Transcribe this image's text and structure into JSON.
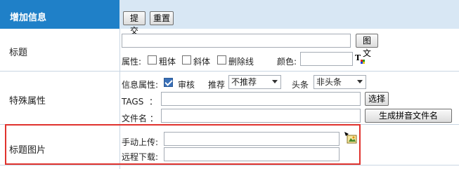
{
  "header": {
    "title": "增加信息",
    "submit_label": "提交",
    "reset_label": "重置"
  },
  "title_row": {
    "label": "标题",
    "title_value": "",
    "tuwen_button": "图文",
    "attr_label": "属性:",
    "bold_label": "粗体",
    "italic_label": "斜体",
    "strike_label": "删除线",
    "color_label": "颜色:",
    "color_value": ""
  },
  "special_row": {
    "label": "特殊属性",
    "info_attr_label": "信息属性:",
    "review_label": "审核",
    "review_checked": true,
    "recommend_label": "推荐",
    "recommend_value": "不推荐",
    "headline_label": "头条",
    "headline_value": "非头条",
    "tags_label": "TAGS  ：",
    "tags_value": "",
    "select_button": "选择",
    "filename_label": "文件名 ：",
    "filename_value": "",
    "pinyin_button": "生成拼音文件名"
  },
  "image_row": {
    "label": "标题图片",
    "manual_upload_label": "手动上传:",
    "manual_upload_value": "",
    "remote_download_label": "远程下载:",
    "remote_download_value": ""
  }
}
